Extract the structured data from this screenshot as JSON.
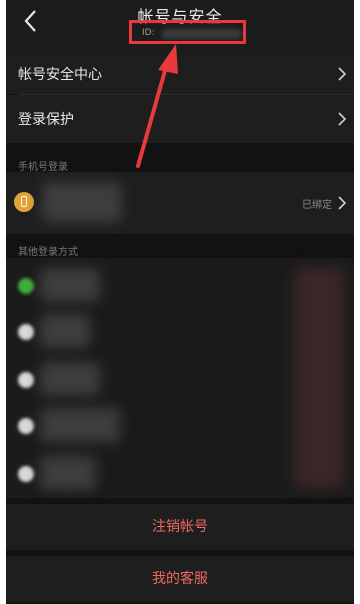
{
  "header": {
    "title": "帐号与安全",
    "id_label": "ID:"
  },
  "menu": {
    "security_center": "帐号安全中心",
    "login_protection": "登录保护"
  },
  "phone_section": {
    "label": "手机号登录",
    "status": "已绑定"
  },
  "other_section": {
    "label": "其他登录方式"
  },
  "actions": {
    "cancel_account": "注销帐号",
    "customer_service": "我的客服"
  },
  "colors": {
    "highlight": "#e83a3a",
    "action_text": "#f06a62"
  }
}
